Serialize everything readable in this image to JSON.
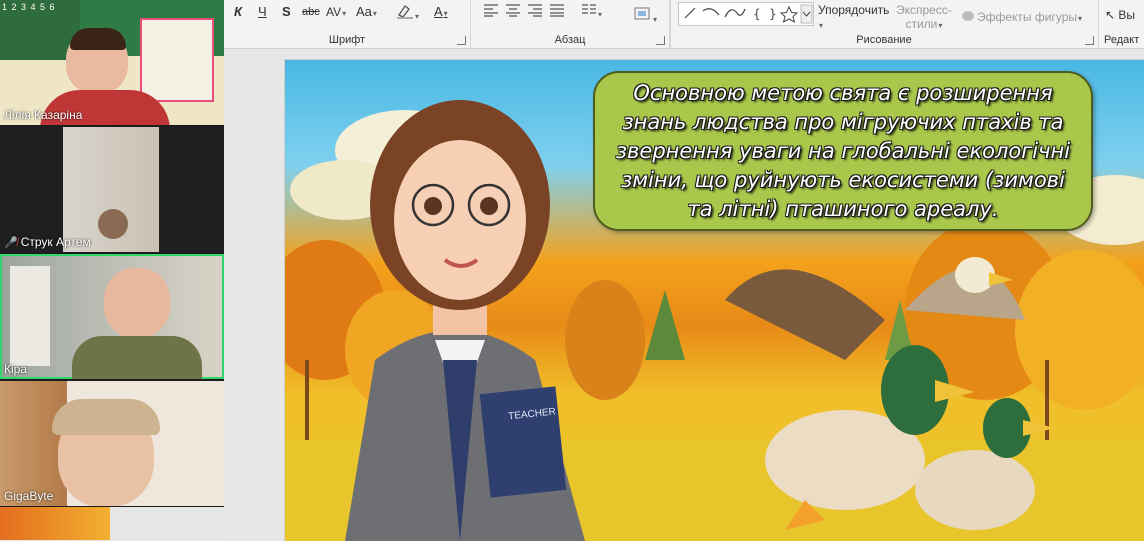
{
  "ribbon": {
    "font_group": "Шрифт",
    "paragraph_group": "Абзац",
    "drawing_group": "Рисование",
    "edit_group_partial": "Редакт",
    "arrange": "Упорядочить",
    "quick_styles_1": "Экспресс-",
    "quick_styles_2": "стили",
    "shape_effects": "Эффекты фигуры",
    "select_partial": "Вы",
    "top_digits": "1 2 3 4 5 6"
  },
  "participants": [
    {
      "name": "Лілія Казаріна"
    },
    {
      "name": "Струк Артем"
    },
    {
      "name": "Кіра"
    },
    {
      "name": "GigaByte"
    }
  ],
  "slide": {
    "callout_text": "Основною метою свята є розширення знань людства про мігруючих птахів та звернення уваги на глобальні екологічні зміни, що руйнують екосистеми (зимові та літні) пташиного ареалу.",
    "book_label": "TEACHER"
  },
  "colors": {
    "callout_fill": "#a9c74b",
    "active_speaker": "#2fd66b",
    "sky": "#49b8e3",
    "autumn": "#f3a21c"
  }
}
